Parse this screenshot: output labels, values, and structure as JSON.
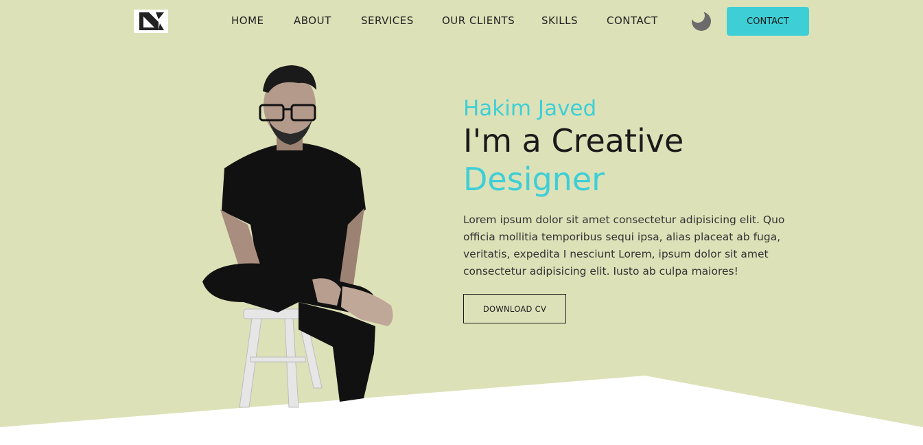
{
  "nav": {
    "items": [
      {
        "label": "HOME"
      },
      {
        "label": "ABOUT"
      },
      {
        "label": "SERVICES"
      },
      {
        "label": "OUR CLIENTS"
      },
      {
        "label": "SKILLS"
      },
      {
        "label": "CONTACT"
      }
    ],
    "contact_button": "CONTACT",
    "theme_icon": "moon-icon"
  },
  "hero": {
    "name": "Hakim Javed",
    "title": "I'm a Creative",
    "accent": "Designer",
    "description": "Lorem ipsum dolor sit amet consectetur adipisicing elit. Quo officia mollitia temporibus sequi ipsa, alias placeat ab fuga, veritatis, expedita I nesciunt Lorem, ipsum dolor sit amet consectetur adipisicing elit. Iusto ab culpa maiores!",
    "cv_button": "DOWNLOAD CV"
  },
  "colors": {
    "background": "#dde1b8",
    "accent": "#3ecfd6",
    "text": "#1a1a1a",
    "white": "#ffffff"
  }
}
